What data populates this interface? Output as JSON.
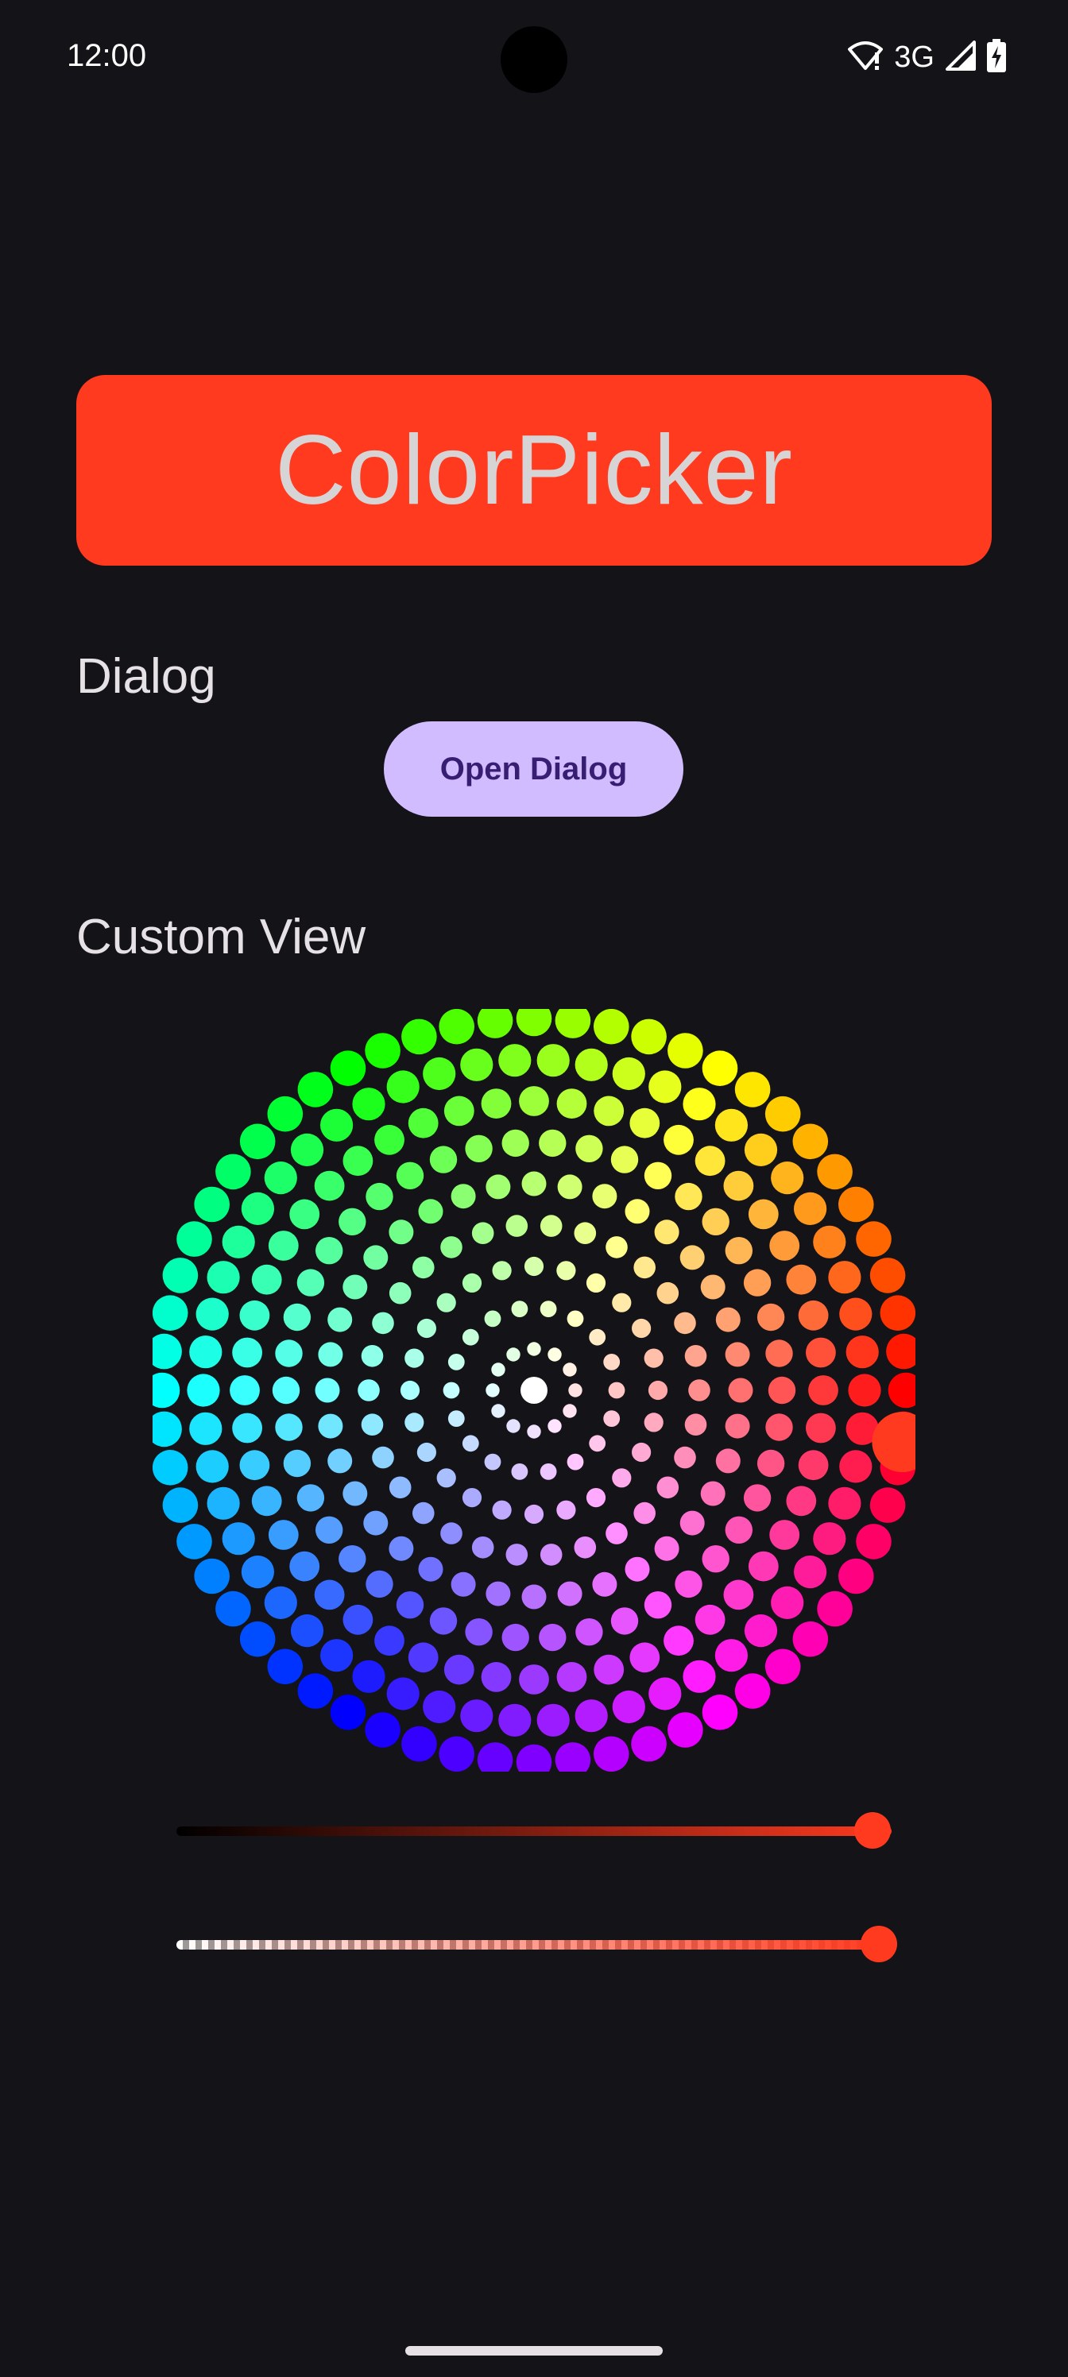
{
  "status_bar": {
    "time": "12:00",
    "network": "3G",
    "icons": [
      "wifi-alert-icon",
      "cell-signal-icon",
      "battery-charging-icon"
    ]
  },
  "header": {
    "title": "ColorPicker",
    "background_color": "#ff3a1f"
  },
  "dialog_section": {
    "label": "Dialog",
    "button_label": "Open Dialog"
  },
  "custom_view_section": {
    "label": "Custom View",
    "selected_color": "#ff3a1f",
    "selected_hue_deg": 8,
    "selected_saturation": 1.0
  },
  "sliders": {
    "brightness_value": 1.0,
    "alpha_value": 1.0
  },
  "colors": {
    "background": "#141318",
    "button_bg": "#d0bcff",
    "button_text": "#381e72"
  }
}
